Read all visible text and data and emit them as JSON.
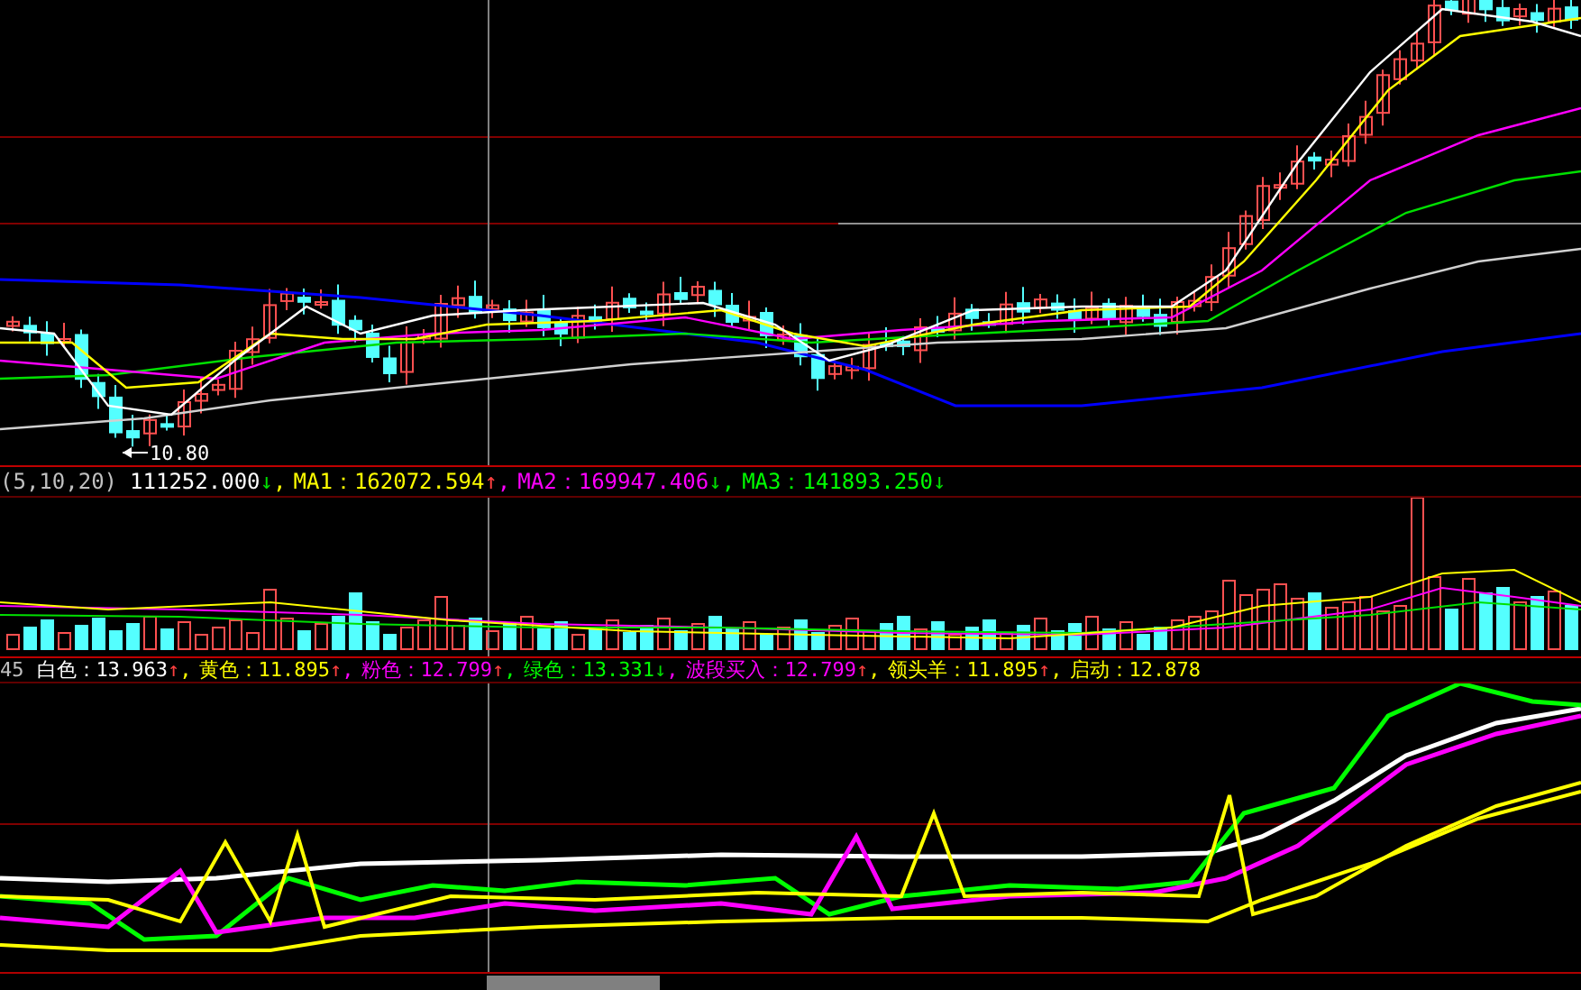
{
  "price_chart": {
    "low_label": "10.80"
  },
  "volume_legend": {
    "params": "(5,10,20)",
    "items": [
      {
        "value": "111252.000",
        "arrow": {
          "symbol": "↓",
          "color": "#00e000"
        },
        "color": "#ffffff"
      },
      {
        "sep": ",",
        "label": "MA1：",
        "value": "162072.594",
        "arrow": {
          "symbol": "↑",
          "color": "#ff4040"
        },
        "color": "#ffff00"
      },
      {
        "sep": ",",
        "label": "MA2：",
        "value": "169947.406",
        "arrow": {
          "symbol": "↓",
          "color": "#00e000"
        },
        "color": "#ff00ff"
      },
      {
        "sep": ",",
        "label": "MA3：",
        "value": "141893.250",
        "arrow": {
          "symbol": "↓",
          "color": "#00e000"
        },
        "color": "#00ff00"
      }
    ]
  },
  "indicator_legend": {
    "params": "45",
    "items": [
      {
        "label": "白色：",
        "value": "13.963",
        "arrow": {
          "symbol": "↑",
          "color": "#ff4040"
        },
        "color": "#ffffff"
      },
      {
        "sep": ",",
        "label": "黄色：",
        "value": "11.895",
        "arrow": {
          "symbol": "↑",
          "color": "#ff4040"
        },
        "color": "#ffff00"
      },
      {
        "sep": ",",
        "label": "粉色：",
        "value": "12.799",
        "arrow": {
          "symbol": "↑",
          "color": "#ff4040"
        },
        "color": "#ff00ff"
      },
      {
        "sep": ",",
        "label": "绿色：",
        "value": "13.331",
        "arrow": {
          "symbol": "↓",
          "color": "#00e000"
        },
        "color": "#00ff00"
      },
      {
        "sep": ",",
        "label": "波段买入：",
        "value": "12.799",
        "arrow": {
          "symbol": "↑",
          "color": "#ff4040"
        },
        "color": "#ff00ff"
      },
      {
        "sep": ",",
        "label": "领头羊：",
        "value": "11.895",
        "arrow": {
          "symbol": "↑",
          "color": "#ff4040"
        },
        "color": "#ffff00"
      },
      {
        "sep": ",",
        "label": "启动：",
        "value": "12.878",
        "color": "#ffff00"
      }
    ]
  }
}
